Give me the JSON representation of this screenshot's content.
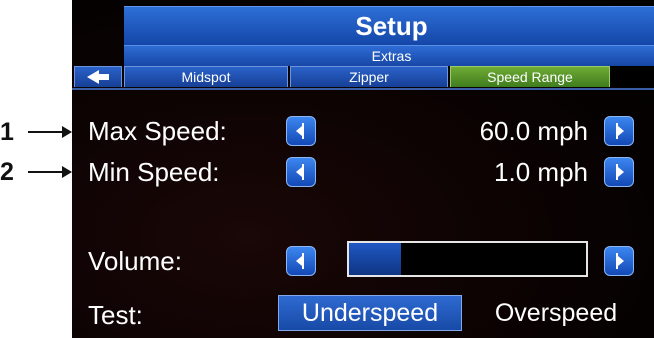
{
  "callouts": [
    {
      "number": "1"
    },
    {
      "number": "2"
    }
  ],
  "screen": {
    "title": "Setup",
    "subtitle": "Extras",
    "tabs": [
      {
        "label": "",
        "icon": "back-arrow-icon",
        "active": false
      },
      {
        "label": "Midspot",
        "active": false
      },
      {
        "label": "Zipper",
        "active": false
      },
      {
        "label": "Speed Range",
        "active": true
      }
    ],
    "settings": {
      "max_speed": {
        "label": "Max Speed:",
        "value": "60.0 mph"
      },
      "min_speed": {
        "label": "Min Speed:",
        "value": "1.0 mph"
      },
      "volume": {
        "label": "Volume:",
        "level_fraction": 0.22
      },
      "test": {
        "label": "Test:",
        "options": [
          "Underspeed",
          "Overspeed"
        ],
        "selected": "Underspeed"
      }
    }
  },
  "colors": {
    "button_blue": "#1f5fcf",
    "active_tab_green": "#5a9a2a",
    "background": "#000000"
  }
}
